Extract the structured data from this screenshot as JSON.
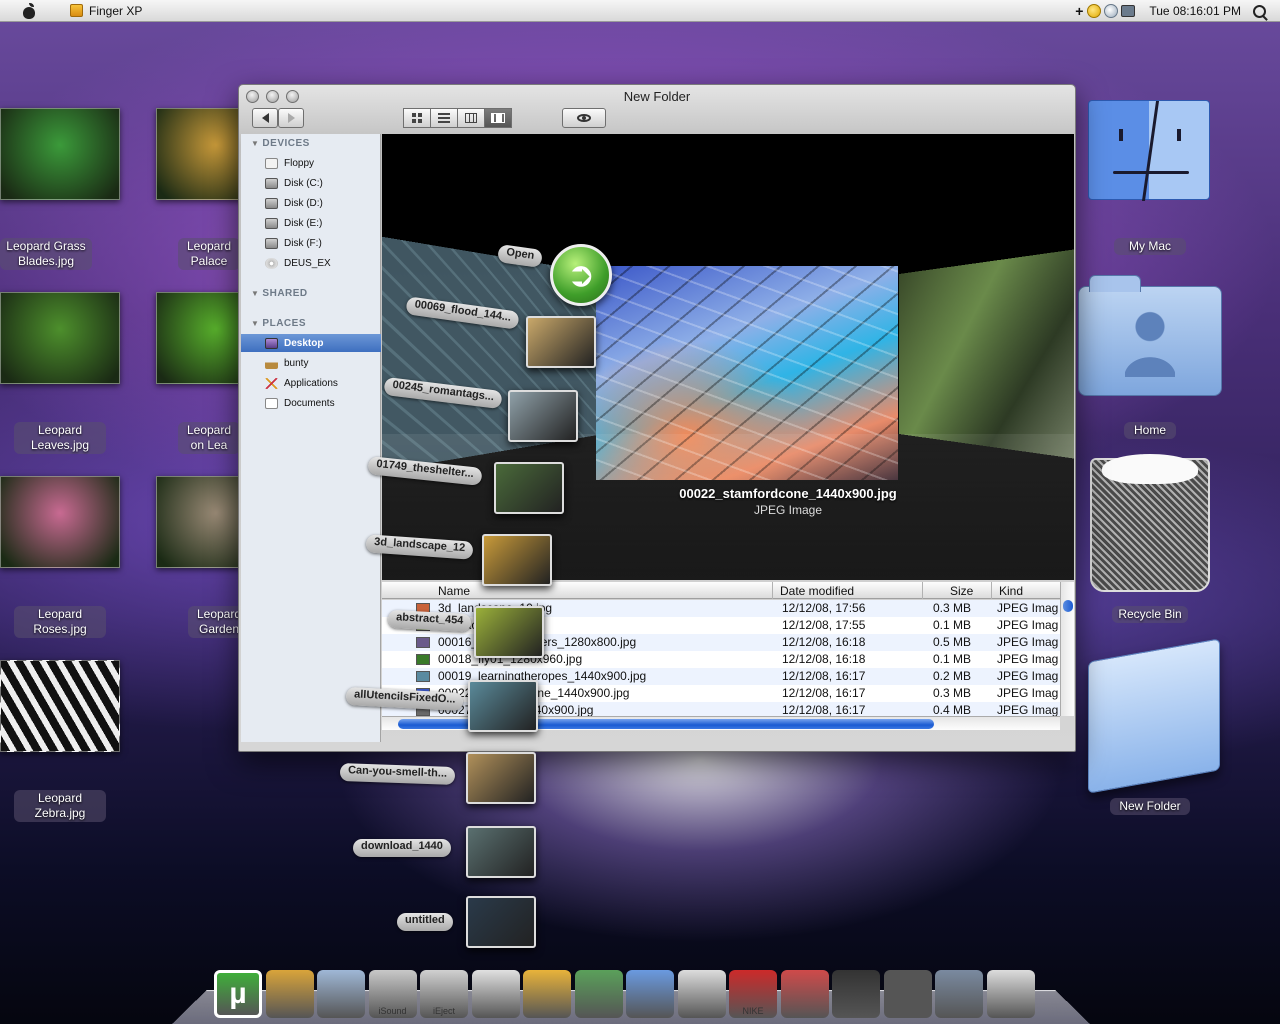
{
  "menubar": {
    "app_name": "Finger XP",
    "plus": "+",
    "clock": "Tue 08:16:01 PM",
    "icons": [
      "apple-icon",
      "app-icon",
      "smiley-icon",
      "network-icon",
      "display-icon",
      "spotlight-icon"
    ]
  },
  "desktop_left": [
    {
      "label": "Leopard Grass Blades.jpg",
      "color": "#3b9a3a"
    },
    {
      "label": "Leopard Palace",
      "color": "#c99a3a"
    },
    {
      "label": "Leopard Leaves.jpg",
      "color": "#4d8f2c"
    },
    {
      "label": "Leopard on Lea",
      "color": "#58b02c"
    },
    {
      "label": "Leopard Roses.jpg",
      "color": "#c86a92"
    },
    {
      "label": "Leopard Garden",
      "color": "#9a8a76"
    },
    {
      "label": "Leopard Zebra.jpg",
      "color": "#222222"
    }
  ],
  "desktop_right": {
    "my_mac": "My Mac",
    "home": "Home",
    "recycle_bin": "Recycle Bin",
    "new_folder": "New Folder"
  },
  "window": {
    "title": "New Folder",
    "sidebar": {
      "devices_header": "DEVICES",
      "devices": [
        "Floppy",
        "Disk (C:)",
        "Disk (D:)",
        "Disk (E:)",
        "Disk (F:)",
        "DEUS_EX"
      ],
      "shared_header": "SHARED",
      "places_header": "PLACES",
      "places": [
        "Desktop",
        "bunty",
        "Applications",
        "Documents"
      ],
      "selected": "Desktop"
    },
    "coverflow": {
      "filename": "00022_stamfordcone_1440x900.jpg",
      "kind": "JPEG Image"
    },
    "list": {
      "columns": [
        "Name",
        "Date modified",
        "Size",
        "Kind"
      ],
      "rows": [
        {
          "name": "3d_landscape_10.jpg",
          "date": "12/12/08, 17:56",
          "size": "0.3 MB",
          "kind": "JPEG Imag",
          "color": "#c8623a"
        },
        {
          "name": "abstract_454.jpg",
          "date": "12/12/08, 17:55",
          "size": "0.1 MB",
          "kind": "JPEG Imag",
          "color": "#7fa04a"
        },
        {
          "name": "00016_buzzingflowers_1280x800.jpg",
          "date": "12/12/08, 16:18",
          "size": "0.5 MB",
          "kind": "JPEG Imag",
          "color": "#6a5a8a"
        },
        {
          "name": "00018_fly01_1280x960.jpg",
          "date": "12/12/08, 16:18",
          "size": "0.1 MB",
          "kind": "JPEG Imag",
          "color": "#3a7a2a"
        },
        {
          "name": "00019_learningtheropes_1440x900.jpg",
          "date": "12/12/08, 16:17",
          "size": "0.2 MB",
          "kind": "JPEG Imag",
          "color": "#5a8aa0"
        },
        {
          "name": "00022_stamfordcone_1440x900.jpg",
          "date": "12/12/08, 16:17",
          "size": "0.3 MB",
          "kind": "JPEG Imag",
          "color": "#3b57c8"
        },
        {
          "name": "00027_granite_1440x900.jpg",
          "date": "12/12/08, 16:17",
          "size": "0.4 MB",
          "kind": "JPEG Imag",
          "color": "#6a6a6a"
        }
      ]
    }
  },
  "stack": {
    "open_label": "Open",
    "items": [
      "00069_flood_144...",
      "00245_romantags...",
      "01749_theshelter...",
      "3d_landscape_12",
      "abstract_454",
      "allUtencilsFixedO...",
      "Can-you-smell-th...",
      "download_1440",
      "untitled"
    ]
  },
  "dock": {
    "items": [
      {
        "name": "utorrent",
        "label": "µ",
        "color": "#3fae3a"
      },
      {
        "name": "app-2",
        "label": "",
        "color": "#d9a43a"
      },
      {
        "name": "folder",
        "label": "",
        "color": "#9fb7d6"
      },
      {
        "name": "isound",
        "label": "iSound",
        "color": "#c8c8c8"
      },
      {
        "name": "eject",
        "label": "iEject",
        "color": "#d0d0d0"
      },
      {
        "name": "stack",
        "label": "",
        "color": "#e0e0e0"
      },
      {
        "name": "finder",
        "label": "",
        "color": "#e8b33a"
      },
      {
        "name": "tasks",
        "label": "",
        "color": "#5aa05a"
      },
      {
        "name": "itunes",
        "label": "",
        "color": "#6a9ae0"
      },
      {
        "name": "drive",
        "label": "",
        "color": "#dcdcdc"
      },
      {
        "name": "nike",
        "label": "NIKE",
        "color": "#cc2a2a"
      },
      {
        "name": "drive-red",
        "label": "",
        "color": "#cf4a4a"
      },
      {
        "name": "clapper",
        "label": "",
        "color": "#333333"
      },
      {
        "name": "screen",
        "label": "",
        "color": "#555555"
      },
      {
        "name": "system-prefs",
        "label": "",
        "color": "#7a8aa0"
      },
      {
        "name": "recycle",
        "label": "",
        "color": "#dcdcdc"
      }
    ]
  }
}
